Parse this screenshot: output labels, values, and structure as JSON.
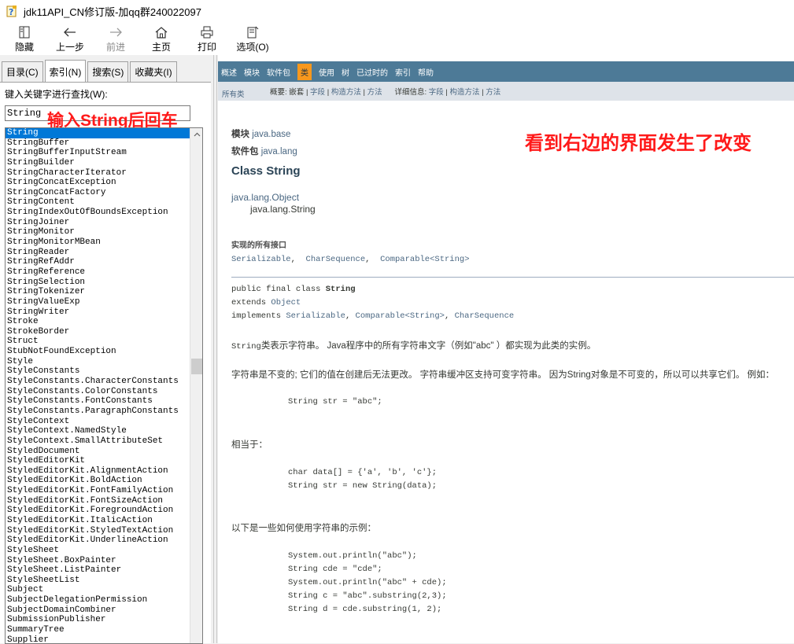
{
  "window": {
    "title": "jdk11API_CN修订版-加qq群240022097"
  },
  "toolbar": {
    "hide": "隐藏",
    "back": "上一步",
    "forward": "前进",
    "home": "主页",
    "print": "打印",
    "options": "选项(O)"
  },
  "tabs": {
    "contents": "目录(C)",
    "index": "索引(N)",
    "search": "搜索(S)",
    "favorites": "收藏夹(I)"
  },
  "index": {
    "label": "键入关键字进行查找(W):",
    "input_value": "String",
    "annotation": "输入String后回车",
    "items": [
      "String",
      "StringBuffer",
      "StringBufferInputStream",
      "StringBuilder",
      "StringCharacterIterator",
      "StringConcatException",
      "StringConcatFactory",
      "StringContent",
      "StringIndexOutOfBoundsException",
      "StringJoiner",
      "StringMonitor",
      "StringMonitorMBean",
      "StringReader",
      "StringRefAddr",
      "StringReference",
      "StringSelection",
      "StringTokenizer",
      "StringValueExp",
      "StringWriter",
      "Stroke",
      "StrokeBorder",
      "Struct",
      "StubNotFoundException",
      "Style",
      "StyleConstants",
      "StyleConstants.CharacterConstants",
      "StyleConstants.ColorConstants",
      "StyleConstants.FontConstants",
      "StyleConstants.ParagraphConstants",
      "StyleContext",
      "StyleContext.NamedStyle",
      "StyleContext.SmallAttributeSet",
      "StyledDocument",
      "StyledEditorKit",
      "StyledEditorKit.AlignmentAction",
      "StyledEditorKit.BoldAction",
      "StyledEditorKit.FontFamilyAction",
      "StyledEditorKit.FontSizeAction",
      "StyledEditorKit.ForegroundAction",
      "StyledEditorKit.ItalicAction",
      "StyledEditorKit.StyledTextAction",
      "StyledEditorKit.UnderlineAction",
      "StyleSheet",
      "StyleSheet.BoxPainter",
      "StyleSheet.ListPainter",
      "StyleSheetList",
      "Subject",
      "SubjectDelegationPermission",
      "SubjectDomainCombiner",
      "SubmissionPublisher",
      "SummaryTree",
      "Supplier"
    ]
  },
  "nav": {
    "items": [
      "概述",
      "模块",
      "软件包",
      "类",
      "使用",
      "树",
      "已过时的",
      "索引",
      "帮助"
    ],
    "active_index": 3,
    "all_classes": "所有类",
    "summary_label": "概要:",
    "summary_nested": "嵌套",
    "summary_field": "字段",
    "summary_constr": "构造方法",
    "summary_method": "方法",
    "detail_label": "详细信息:",
    "detail_field": "字段",
    "detail_constr": "构造方法",
    "detail_method": "方法",
    "sep": "|"
  },
  "doc": {
    "annotation": "看到右边的界面发生了改变",
    "module_label": "模块",
    "module_value": "java.base",
    "package_label": "软件包",
    "package_value": "java.lang",
    "class_title": "Class String",
    "inherit_parent": "java.lang.Object",
    "inherit_child": "java.lang.String",
    "interfaces_title": "实现的所有接口",
    "interfaces": [
      "Serializable",
      "CharSequence",
      "Comparable<String>"
    ],
    "iface_sep": ",",
    "sig_line1_pre": "public final class ",
    "sig_line1_name": "String",
    "sig_extends": "extends ",
    "sig_extends_type": "Object",
    "sig_implements": "implements ",
    "sig_impl_1": "Serializable",
    "sig_impl_2": "Comparable<String>",
    "sig_impl_3": "CharSequence",
    "sig_impl_sep": ", ",
    "desc1_code": "String",
    "desc1_text": "类表示字符串。 Java程序中的所有字符串文字（例如\"abc\" ）都实现为此类的实例。",
    "desc2": "字符串是不变的; 它们的值在创建后无法更改。 字符串缓冲区支持可变字符串。 因为String对象是不可变的，所以可以共享它们。 例如：",
    "code1": "String str = \"abc\";",
    "equiv": "相当于：",
    "code2_1": "char data[] = {'a', 'b', 'c'};",
    "code2_2": " String str = new String(data);",
    "examples": "以下是一些如何使用字符串的示例：",
    "code3_1": "System.out.println(\"abc\");",
    "code3_2": " String cde = \"cde\";",
    "code3_3": " System.out.println(\"abc\" + cde);",
    "code3_4": " String c = \"abc\".substring(2,3);",
    "code3_5": " String d = cde.substring(1, 2);"
  }
}
